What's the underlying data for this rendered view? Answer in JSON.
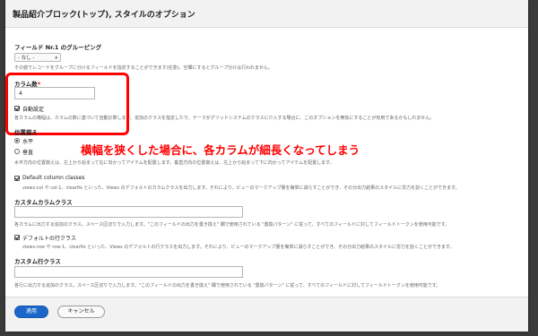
{
  "dialog": {
    "title": "製品紹介ブロック(トップ), スタイルのオプション"
  },
  "grouping": {
    "label": "フィールド Nr.1 のグルーピング",
    "selected": "- なし -",
    "description": "その値でレコードをグループに分けるフィールドを指定することができます(任意)。空欄にするとグループ分けは行われません。"
  },
  "columns": {
    "label": "カラム数",
    "required_mark": "*",
    "value": "4",
    "auto_label": "自動設定",
    "auto_checked": true,
    "auto_description": "各カラムの横幅は、カラムの数に基づいて自動計算します。追加のクラスを指定したり、テーマがグリッドシステムのクラスに介入する場合に、このオプションを無効にすることが有用であるかもしれません。"
  },
  "annotation": "横幅を狭くした場合に、各カラムが細長くなってしまう",
  "alignment": {
    "label": "位置揃え",
    "options": [
      "水平",
      "垂直"
    ],
    "selected": "水平",
    "description": "水平方向の位置揃えは、左上から始まって右に向かってアイテムを配置します。垂直方向の位置揃えは、左上から始まって下に向かってアイテムを配置します。"
  },
  "default_column_classes": {
    "label": "Default column classes",
    "checked": true,
    "description": "views-col や col-1、clearfix といった、Views のデフォルトのカラムクラスを出力します。それにより、ビューのマークアップ量を簡単に減らすことができ、その分出力結果のスタイルに労力を割くことができます。"
  },
  "custom_column_class": {
    "label": "カスタムカラムクラス",
    "value": "",
    "description": "各カラムに出力する追加のクラス。スペース区切りで入力します。\"このフィールドの出力を書き換え\" 欄で使用されている \"置換パターン\" に従って、すべてのフィールドに対してフィールドトークンを使用可能です。"
  },
  "default_row_classes": {
    "label": "デフォルトの行クラス",
    "checked": true,
    "description": "views-row や row-1、clearfix といった、Views のデフォルトの行クラスを出力します。それにより、ビューのマークアップ量を簡単に減らすことができ、その分出力結果のスタイルに労力を割くことができます。"
  },
  "custom_row_class": {
    "label": "カスタム行クラス",
    "value": "",
    "description": "各行に出力する追加のクラス。スペース区切りで入力します。\"このフィールドの出力を書き換え\" 欄で使用されている \"置換パターン\" に従って、すべてのフィールドに対してフィールドトークンを使用可能です。"
  },
  "footer": {
    "apply_label": "適用",
    "cancel_label": "キャンセル"
  },
  "colors": {
    "primary_button": "#1a66c9",
    "annotation_red": "#ff0000",
    "required": "#e00000"
  }
}
